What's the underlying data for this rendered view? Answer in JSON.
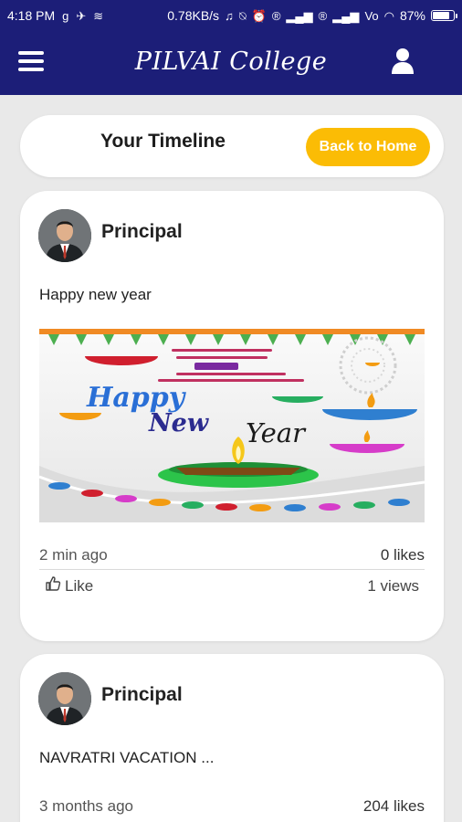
{
  "status_bar": {
    "time": "4:18 PM",
    "speed": "0.78KB/s",
    "battery": "87%",
    "battery_level": 0.87
  },
  "app_bar": {
    "title": "PILVAI College",
    "menu_icon": "hamburger-icon",
    "profile_icon": "user-icon"
  },
  "header": {
    "title": "Your Timeline",
    "home_button": "Back to Home"
  },
  "posts": [
    {
      "author": "Principal",
      "text": "Happy new year",
      "time": "2 min ago",
      "likes": "0 likes",
      "like_label": "Like",
      "views": "1 views",
      "image_text": {
        "line1": "Happy",
        "line2": "New",
        "line3": "Year"
      }
    },
    {
      "author": "Principal",
      "text": "NAVRATRI VACATION ...",
      "time": "3 months ago",
      "likes": "204 likes"
    }
  ],
  "colors": {
    "primary": "#1c1e78",
    "accent": "#fbbc05",
    "background": "#e9e9e9"
  }
}
